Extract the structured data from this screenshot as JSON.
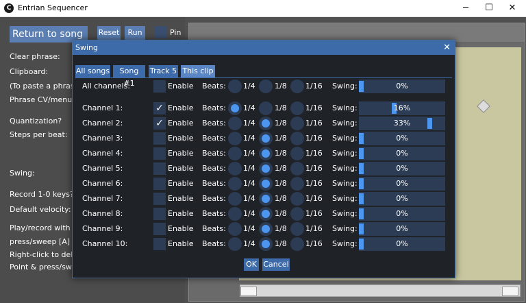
{
  "window": {
    "title": "Entrian Sequencer",
    "logo": "C"
  },
  "winbtns": {
    "min": "─",
    "max": "☐",
    "close": "✕"
  },
  "left": {
    "return_btn": "Return to song",
    "reset": "Reset",
    "run": "Run",
    "pin": "Pin",
    "labels": [
      "Clear phrase:",
      "Clipboard:",
      "(To paste a phrase",
      "Phrase CV/menu:",
      "Quantization?",
      "Steps per beat:",
      "Swing:",
      "Record 1-0 keys?",
      "Default velocity:",
      "Play/record with k",
      "press/sweep [A] to",
      "Right-click to dele",
      "Point & press/swee"
    ]
  },
  "dialog": {
    "title": "Swing",
    "close": "✕",
    "tabs": [
      "All songs",
      "Song #1",
      "Track 5",
      "This clip"
    ],
    "active_tab": "This clip",
    "enable_label": "Enable",
    "beats_label": "Beats:",
    "swing_label": "Swing:",
    "beat_options": [
      "1/4",
      "1/8",
      "1/16"
    ],
    "rows": [
      {
        "name": "All channels:",
        "enabled": false,
        "check": "",
        "beat": "",
        "swing": 0,
        "swing_text": "0%"
      },
      {
        "name": "Channel 1:",
        "enabled": true,
        "check": "✓",
        "beat": "1/4",
        "swing": 16,
        "swing_text": "16%"
      },
      {
        "name": "Channel 2:",
        "enabled": true,
        "check": "✓",
        "beat": "1/8",
        "swing": 33,
        "swing_text": "33%"
      },
      {
        "name": "Channel 3:",
        "enabled": false,
        "check": "",
        "beat": "1/8",
        "swing": 0,
        "swing_text": "0%"
      },
      {
        "name": "Channel 4:",
        "enabled": false,
        "check": "",
        "beat": "1/8",
        "swing": 0,
        "swing_text": "0%"
      },
      {
        "name": "Channel 5:",
        "enabled": false,
        "check": "",
        "beat": "1/8",
        "swing": 0,
        "swing_text": "0%"
      },
      {
        "name": "Channel 6:",
        "enabled": false,
        "check": "",
        "beat": "1/8",
        "swing": 0,
        "swing_text": "0%"
      },
      {
        "name": "Channel 7:",
        "enabled": false,
        "check": "",
        "beat": "1/8",
        "swing": 0,
        "swing_text": "0%"
      },
      {
        "name": "Channel 8:",
        "enabled": false,
        "check": "",
        "beat": "1/8",
        "swing": 0,
        "swing_text": "0%"
      },
      {
        "name": "Channel 9:",
        "enabled": false,
        "check": "",
        "beat": "1/8",
        "swing": 0,
        "swing_text": "0%"
      },
      {
        "name": "Channel 10:",
        "enabled": false,
        "check": "",
        "beat": "1/8",
        "swing": 0,
        "swing_text": "0%"
      }
    ],
    "ok": "OK",
    "cancel": "Cancel"
  },
  "colors": {
    "accent": "#3d6aa8",
    "radio_on": "#4d96f0",
    "dialog_bg": "#1f2328"
  }
}
